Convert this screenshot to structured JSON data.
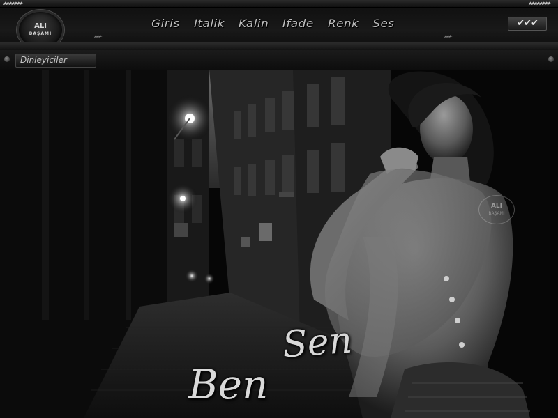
{
  "logo": {
    "top": "ALI",
    "bottom": "BAŞAMİ"
  },
  "menu": [
    "Giris",
    "Italik",
    "Kalin",
    "Ifade",
    "Renk",
    "Ses"
  ],
  "subbar": {
    "label": "Dinleyiciler"
  },
  "title": {
    "line1": "Sen",
    "line2": "Ben"
  },
  "icons": {
    "right_control": "check-icons"
  },
  "colors": {
    "background": "#050505",
    "text": "#bdbdbd"
  }
}
